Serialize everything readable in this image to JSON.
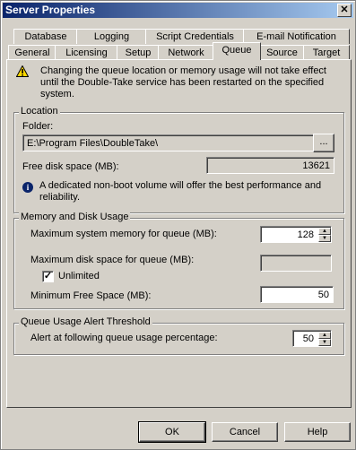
{
  "window": {
    "title": "Server Properties",
    "close_glyph": "✕"
  },
  "tabs_row1": [
    "Database",
    "Logging",
    "Script Credentials",
    "E-mail Notification"
  ],
  "tabs_row2": [
    "General",
    "Licensing",
    "Setup",
    "Network",
    "Queue",
    "Source",
    "Target"
  ],
  "active_tab": "Queue",
  "warning": {
    "icon": "warning-icon",
    "text": "Changing the queue location or memory usage will not take effect until the Double-Take service has been restarted on the specified system."
  },
  "location": {
    "legend": "Location",
    "folder_label": "Folder:",
    "folder_value": "E:\\Program Files\\DoubleTake\\",
    "browse_label": "...",
    "free_disk_label": "Free disk space (MB):",
    "free_disk_value": "13621",
    "info_icon": "info-icon",
    "info_text": "A dedicated non-boot volume will offer the best performance and reliability."
  },
  "memory": {
    "legend": "Memory and Disk Usage",
    "max_memory_label": "Maximum system memory for queue (MB):",
    "max_memory_value": "128",
    "max_disk_label": "Maximum disk space for queue (MB):",
    "max_disk_value": "",
    "unlimited_label": "Unlimited",
    "unlimited_checked": true,
    "min_free_label": "Minimum Free Space (MB):",
    "min_free_value": "50"
  },
  "alert": {
    "legend": "Queue Usage Alert Threshold",
    "label": "Alert at following queue usage percentage:",
    "value": "50"
  },
  "buttons": {
    "ok": "OK",
    "cancel": "Cancel",
    "help": "Help"
  }
}
